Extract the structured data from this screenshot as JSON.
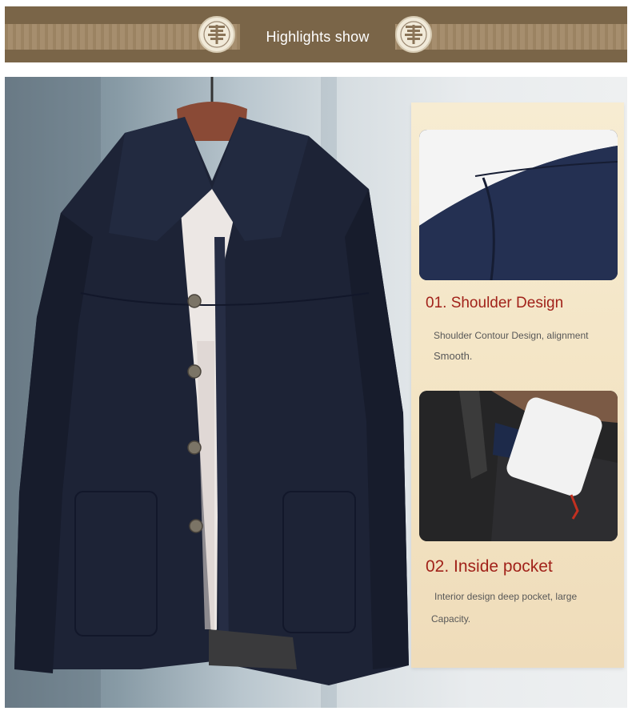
{
  "banner": {
    "title": "Highlights show",
    "colors": {
      "band": "#7a6548",
      "pattern": "#b49c7b",
      "medallion": "#f1ead9"
    }
  },
  "features": [
    {
      "title": "01. Shoulder Design",
      "description_line1": "Shoulder Contour Design, alignment",
      "description_line2": "Smooth."
    },
    {
      "title": "02. Inside pocket",
      "description_line1": "Interior design deep pocket, large",
      "description_line2": "Capacity."
    }
  ],
  "colors": {
    "accent_red": "#a1221a",
    "card_bg": "#f5e8cb",
    "jacket_navy": "#1d2336",
    "text_gray": "#585858"
  },
  "icons": [
    "longevity-medallion-icon",
    "longevity-medallion-icon"
  ]
}
